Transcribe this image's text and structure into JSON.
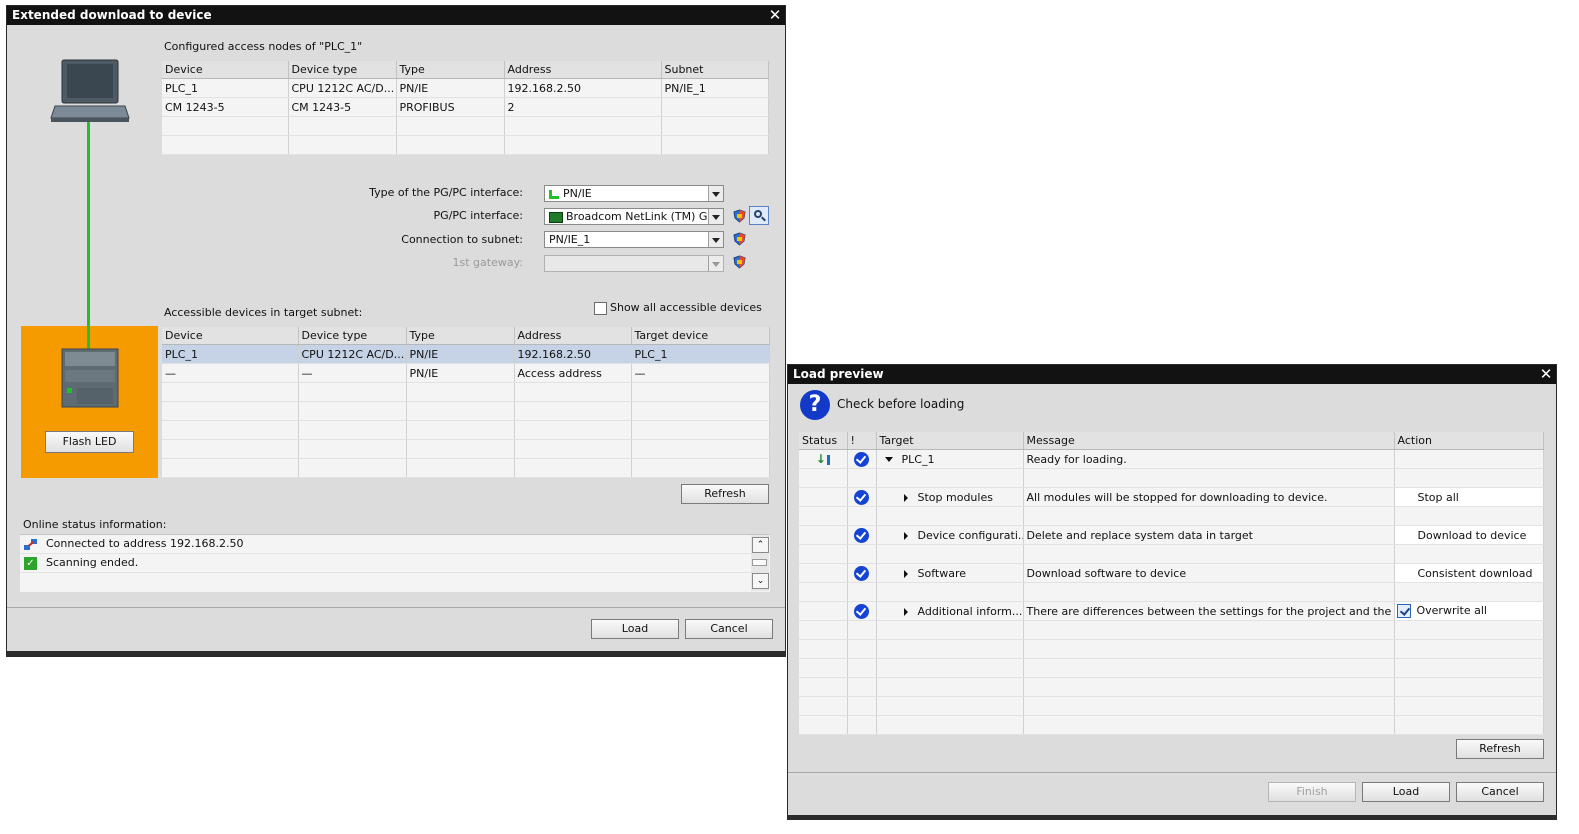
{
  "extended": {
    "title": "Extended download to device",
    "configured_heading": "Configured access nodes of \"PLC_1\"",
    "configured_columns": [
      "Device",
      "Device type",
      "Type",
      "Address",
      "Subnet"
    ],
    "configured_rows": [
      [
        "PLC_1",
        "CPU 1212C AC/D...",
        "PN/IE",
        "192.168.2.50",
        "PN/IE_1"
      ],
      [
        "CM 1243-5",
        "CM 1243-5",
        "PROFIBUS",
        "2",
        ""
      ],
      [
        "",
        "",
        "",
        "",
        ""
      ],
      [
        "",
        "",
        "",
        "",
        ""
      ]
    ],
    "iface_type_label": "Type of the PG/PC interface:",
    "iface_type_value": "PN/IE",
    "iface_label": "PG/PC interface:",
    "iface_value": "Broadcom NetLink (TM) G...",
    "subnet_label": "Connection to subnet:",
    "subnet_value": "PN/IE_1",
    "gateway_label": "1st gateway:",
    "gateway_value": "",
    "accessible_heading": "Accessible devices in target subnet:",
    "show_all_label": "Show all accessible devices",
    "show_all_checked": false,
    "accessible_columns": [
      "Device",
      "Device type",
      "Type",
      "Address",
      "Target device"
    ],
    "accessible_rows": [
      [
        "PLC_1",
        "CPU 1212C AC/D...",
        "PN/IE",
        "192.168.2.50",
        "PLC_1"
      ],
      [
        "—",
        "—",
        "PN/IE",
        "Access address",
        "—"
      ],
      [
        "",
        "",
        "",
        "",
        ""
      ],
      [
        "",
        "",
        "",
        "",
        ""
      ],
      [
        "",
        "",
        "",
        "",
        ""
      ],
      [
        "",
        "",
        "",
        "",
        ""
      ],
      [
        "",
        "",
        "",
        "",
        ""
      ]
    ],
    "flash_led_label": "Flash LED",
    "refresh_label": "Refresh",
    "online_status_heading": "Online status information:",
    "status_messages": [
      {
        "icon": "network-connected-icon",
        "text": "Connected to address 192.168.2.50"
      },
      {
        "icon": "green-check-icon",
        "text": "Scanning ended."
      }
    ],
    "load_label": "Load",
    "cancel_label": "Cancel",
    "colors": {
      "device_panel": "#f59b00",
      "connection_line": "#22c12a",
      "selection": "#c6d3e6"
    }
  },
  "preview": {
    "title": "Load preview",
    "heading": "Check before loading",
    "columns": [
      "Status",
      "!",
      "Target",
      "Message",
      "Action"
    ],
    "rows": [
      {
        "status_icon": "download-arrow-icon",
        "checked": true,
        "expander": "expanded",
        "indent": 0,
        "target": "PLC_1",
        "message": "Ready for loading.",
        "action": "",
        "action_checkbox": false
      },
      {
        "status_icon": "",
        "checked": false,
        "expander": "",
        "indent": 0,
        "target": "",
        "message": "",
        "action": "",
        "action_checkbox": false
      },
      {
        "status_icon": "",
        "checked": true,
        "expander": "collapsed",
        "indent": 1,
        "target": "Stop modules",
        "message": "All modules will be stopped for downloading to device.",
        "action": "Stop all",
        "action_checkbox": false
      },
      {
        "status_icon": "",
        "checked": false,
        "expander": "",
        "indent": 0,
        "target": "",
        "message": "",
        "action": "",
        "action_checkbox": false
      },
      {
        "status_icon": "",
        "checked": true,
        "expander": "collapsed",
        "indent": 1,
        "target": "Device configurati...",
        "message": "Delete and replace system data in target",
        "action": "Download to device",
        "action_checkbox": false
      },
      {
        "status_icon": "",
        "checked": false,
        "expander": "",
        "indent": 0,
        "target": "",
        "message": "",
        "action": "",
        "action_checkbox": false
      },
      {
        "status_icon": "",
        "checked": true,
        "expander": "collapsed",
        "indent": 1,
        "target": "Software",
        "message": "Download software to device",
        "action": "Consistent download",
        "action_checkbox": false
      },
      {
        "status_icon": "",
        "checked": false,
        "expander": "",
        "indent": 0,
        "target": "",
        "message": "",
        "action": "",
        "action_checkbox": false
      },
      {
        "status_icon": "",
        "checked": true,
        "expander": "collapsed",
        "indent": 1,
        "target": "Additional inform...",
        "message": "There are differences between the settings for the project and the se",
        "action": "Overwrite all",
        "action_checkbox": true
      },
      {
        "status_icon": "",
        "checked": false,
        "expander": "",
        "indent": 0,
        "target": "",
        "message": "",
        "action": "",
        "action_checkbox": false
      },
      {
        "status_icon": "",
        "checked": false,
        "expander": "",
        "indent": 0,
        "target": "",
        "message": "",
        "action": "",
        "action_checkbox": false
      },
      {
        "status_icon": "",
        "checked": false,
        "expander": "",
        "indent": 0,
        "target": "",
        "message": "",
        "action": "",
        "action_checkbox": false
      },
      {
        "status_icon": "",
        "checked": false,
        "expander": "",
        "indent": 0,
        "target": "",
        "message": "",
        "action": "",
        "action_checkbox": false
      },
      {
        "status_icon": "",
        "checked": false,
        "expander": "",
        "indent": 0,
        "target": "",
        "message": "",
        "action": "",
        "action_checkbox": false
      },
      {
        "status_icon": "",
        "checked": false,
        "expander": "",
        "indent": 0,
        "target": "",
        "message": "",
        "action": "",
        "action_checkbox": false
      }
    ],
    "refresh_label": "Refresh",
    "finish_label": "Finish",
    "load_label": "Load",
    "cancel_label": "Cancel"
  }
}
